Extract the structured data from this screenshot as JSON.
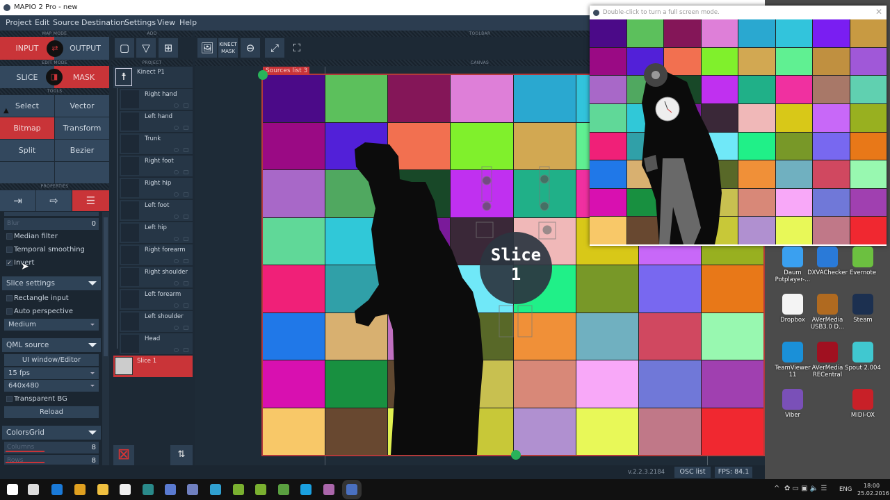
{
  "window": {
    "title": "MAPIO 2 Pro - new"
  },
  "menu": [
    "Project",
    "Edit",
    "Source",
    "Destination",
    "Settings",
    "View",
    "Help"
  ],
  "sections": {
    "map_mode": "MAP MODE",
    "edit_mode": "EDIT MODE",
    "tools": "TOOLS",
    "properties": "PROPERTIES",
    "add": "ADD",
    "project": "PROJECT",
    "toolbar": "TOOLBAR",
    "canvas": "CANVAS"
  },
  "map_mode": {
    "input": "INPUT",
    "output": "OUTPUT",
    "active": "input"
  },
  "edit_mode": {
    "slice": "SLICE",
    "mask": "MASK",
    "active": "mask"
  },
  "tools": [
    "Select",
    "Vector",
    "Bitmap",
    "Transform",
    "Split",
    "Bezier"
  ],
  "active_tool": "Bitmap",
  "properties": {
    "blur": {
      "label": "Blur",
      "value": "0"
    },
    "median_filter": {
      "label": "Median filter",
      "checked": false
    },
    "temporal_smoothing": {
      "label": "Temporal smoothing",
      "checked": false
    },
    "invert": {
      "label": "Invert",
      "checked": true
    },
    "slice_settings": {
      "title": "Slice settings",
      "rectangle_input": "Rectangle input",
      "auto_perspective": "Auto perspective",
      "quality": "Medium"
    },
    "qml_source": {
      "title": "QML source",
      "editor_button": "UI window/Editor",
      "fps": "15 fps",
      "resolution": "640x480",
      "transparent_bg": "Transparent BG",
      "reload": "Reload"
    },
    "colors_grid": {
      "title": "ColorsGrid",
      "columns_label": "Columns",
      "columns": "8",
      "rows_label": "Rows",
      "rows": "8"
    }
  },
  "project_tree": {
    "root": "Kinect P1",
    "children": [
      "Right hand",
      "Left hand",
      "Trunk",
      "Right foot",
      "Right hip",
      "Left foot",
      "Left hip",
      "Right forearm",
      "Right shoulder",
      "Left forearm",
      "Left shoulder",
      "Head"
    ],
    "slice": "Slice 1"
  },
  "canvas": {
    "source_tab": "Sources list 3",
    "slice_label": "Slice",
    "slice_number": "1",
    "grid_colors": [
      [
        "#4b0a88",
        "#5cc05c",
        "#841658",
        "#de7fd8",
        "#2aa8d0",
        "#32c4dc",
        "#7a1ef2",
        "#c89a42"
      ],
      [
        "#9a0a84",
        "#5220d8",
        "#f27050",
        "#80f02c",
        "#d2a852",
        "#60f092",
        "#c09040",
        "#a058d8"
      ],
      [
        "#a868c8",
        "#50a860",
        "#184828",
        "#c030f0",
        "#20b088",
        "#f030a0",
        "#a87868",
        "#60d0b0"
      ],
      [
        "#60d898",
        "#30c8d8",
        "#7a1a9a",
        "#3a2838",
        "#f0b8b8",
        "#d8c818",
        "#c868f8",
        "#98b020"
      ],
      [
        "#f02078",
        "#30a0a8",
        "#5a8fc0",
        "#70e8f8",
        "#20f088",
        "#789828",
        "#7868f0",
        "#e87818"
      ],
      [
        "#2078e8",
        "#d8b070",
        "#c070c0",
        "#586828",
        "#f09038",
        "#70b0c0",
        "#d04860",
        "#98f8b0"
      ],
      [
        "#d810b0",
        "#189040",
        "#604830",
        "#c8c050",
        "#d88878",
        "#f8a8f8",
        "#7078d8",
        "#a040b0"
      ],
      [
        "#f8c868",
        "#684830",
        "#e0f050",
        "#c8c838",
        "#b090d0",
        "#e8f858",
        "#c07888",
        "#f02830"
      ]
    ]
  },
  "status": {
    "version": "v.2.2.3.2184",
    "osc": "OSC list",
    "fps": "FPS: 84.1"
  },
  "output_window": {
    "title": "Double-click to turn a full screen mode."
  },
  "desktop_icons": [
    {
      "label": "Daum Potplayer-...",
      "color": "#3aa0f0"
    },
    {
      "label": "DXVAChecker",
      "color": "#2a7ad8"
    },
    {
      "label": "Evernote",
      "color": "#6cc040"
    },
    {
      "label": "Dropbox",
      "color": "#f4f4f4"
    },
    {
      "label": "AVerMedia USB3.0 D...",
      "color": "#b06a20"
    },
    {
      "label": "Steam",
      "color": "#1c3050"
    },
    {
      "label": "TeamViewer 11",
      "color": "#1a90d8"
    },
    {
      "label": "AVerMedia RECentral",
      "color": "#a01020"
    },
    {
      "label": "Spout 2.004",
      "color": "#40c8d0"
    },
    {
      "label": "Viber",
      "color": "#7a50b8"
    },
    {
      "label": "MIDI-OX",
      "color": "#c82028"
    }
  ],
  "taskbar": {
    "apps": [
      "start",
      "task-view",
      "edge",
      "chrome",
      "file-explorer",
      "app-cat",
      "app-terminal",
      "network-app",
      "vpn",
      "app-globe",
      "qlik-1",
      "qlik-2",
      "evernote",
      "skype",
      "more-app",
      "mapio"
    ],
    "language": "ENG",
    "time": "18:00",
    "date": "25.02.2016"
  }
}
